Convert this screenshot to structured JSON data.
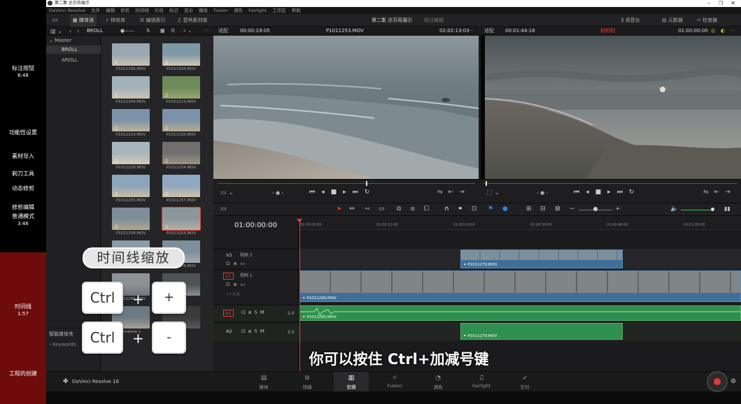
{
  "chapters": [
    {
      "label": "标注按钮",
      "time": "6:48"
    },
    {
      "label": "功能性设置",
      "time": ""
    },
    {
      "label": "素材导入",
      "time": ""
    },
    {
      "label": "剃刀工具",
      "time": ""
    },
    {
      "label": "动态修剪",
      "time": ""
    },
    {
      "label": "修剪编辑",
      "time": ""
    },
    {
      "label": "普通模式",
      "time": "3:46"
    },
    {
      "label": "时间线",
      "time": "1:57"
    },
    {
      "label": "工程的创建",
      "time": ""
    }
  ],
  "window_title": "第二集 达芬奇展示",
  "menu": [
    "DaVinci Resolve",
    "文件",
    "编辑",
    "修剪",
    "时间线",
    "片段",
    "标记",
    "显示",
    "播放",
    "Fusion",
    "调色",
    "Fairlight",
    "工作区",
    "帮助"
  ],
  "toolbar": {
    "media_pool": "媒体池",
    "effects": "特效库",
    "edit_index": "编辑索引",
    "sound_library": "音响素材库",
    "project_title": "第二集 达芬奇展示",
    "project_status": "经过编辑",
    "mixer": "调音台",
    "metadata": "元数据",
    "inspector": "检查器"
  },
  "subbar": {
    "bin_name": "BROLL",
    "source_fit": "适配",
    "source_tc": "00:00:19:05",
    "source_clip": "P1011253.MOV",
    "source_duration": "02:02:13:03",
    "timeline_fit": "适配",
    "timeline_duration": "00:01:44:16",
    "timeline_name": "相相相",
    "timeline_tc": "01:00:00:00"
  },
  "bins": {
    "master": "Master",
    "items": [
      "BROLL",
      "AROLL"
    ],
    "smart_bins": "智能媒体夹",
    "keywords": "Keywords"
  },
  "clips": [
    "P1011296.MOV",
    "P1011304.MOV",
    "P1011309.MOV",
    "P1011213.MOV",
    "P1011214.MOV",
    "P1011220.MOV",
    "P1011229.MOV",
    "P1011254.MOV",
    "P1011255.MOV",
    "P1011257.MOV",
    "P1011258.MOV",
    "P1011253.MOV",
    "",
    "P1011279.MOV",
    "P1011295.MOV",
    "",
    "Timeline 1",
    ""
  ],
  "timeline": {
    "current_tc": "01:00:00:00",
    "ticks": [
      "01:00:00:00",
      "01:00:12:00",
      "01:00:24:00",
      "01:00:36:00",
      "01:00:48:00",
      "01:01:00:00"
    ],
    "tracks": {
      "v2": {
        "id": "V2",
        "name": "视频 2"
      },
      "v1": {
        "id": "V1",
        "name": "视频 1",
        "clips_info": "1个片段"
      },
      "a1": {
        "id": "A1",
        "level": "2.0"
      },
      "a2": {
        "id": "A2",
        "level": "2.0"
      }
    },
    "clip_v2": "P1011279.MOV",
    "clip_v1": "P1011295.MOV",
    "clip_a1": "P1011295.MOV",
    "clip_a2": "P1011279.MOV"
  },
  "pages": [
    "媒体",
    "快编",
    "剪辑",
    "Fusion",
    "调色",
    "Fairlight",
    "交付"
  ],
  "active_page": "剪辑",
  "app_name": "DaVinci Resolve 16",
  "overlay": {
    "zoom_label": "时间线缩放",
    "key_ctrl": "Ctrl",
    "key_plus": "+",
    "key_minus": "-",
    "subtitle": "你可以按住 Ctrl+加减号键"
  },
  "colors": {
    "accent_red": "#e23a3a",
    "video_clip": "#3f6f99",
    "audio_clip": "#2f8f4e",
    "chapter_active": "#6e0b0b"
  }
}
